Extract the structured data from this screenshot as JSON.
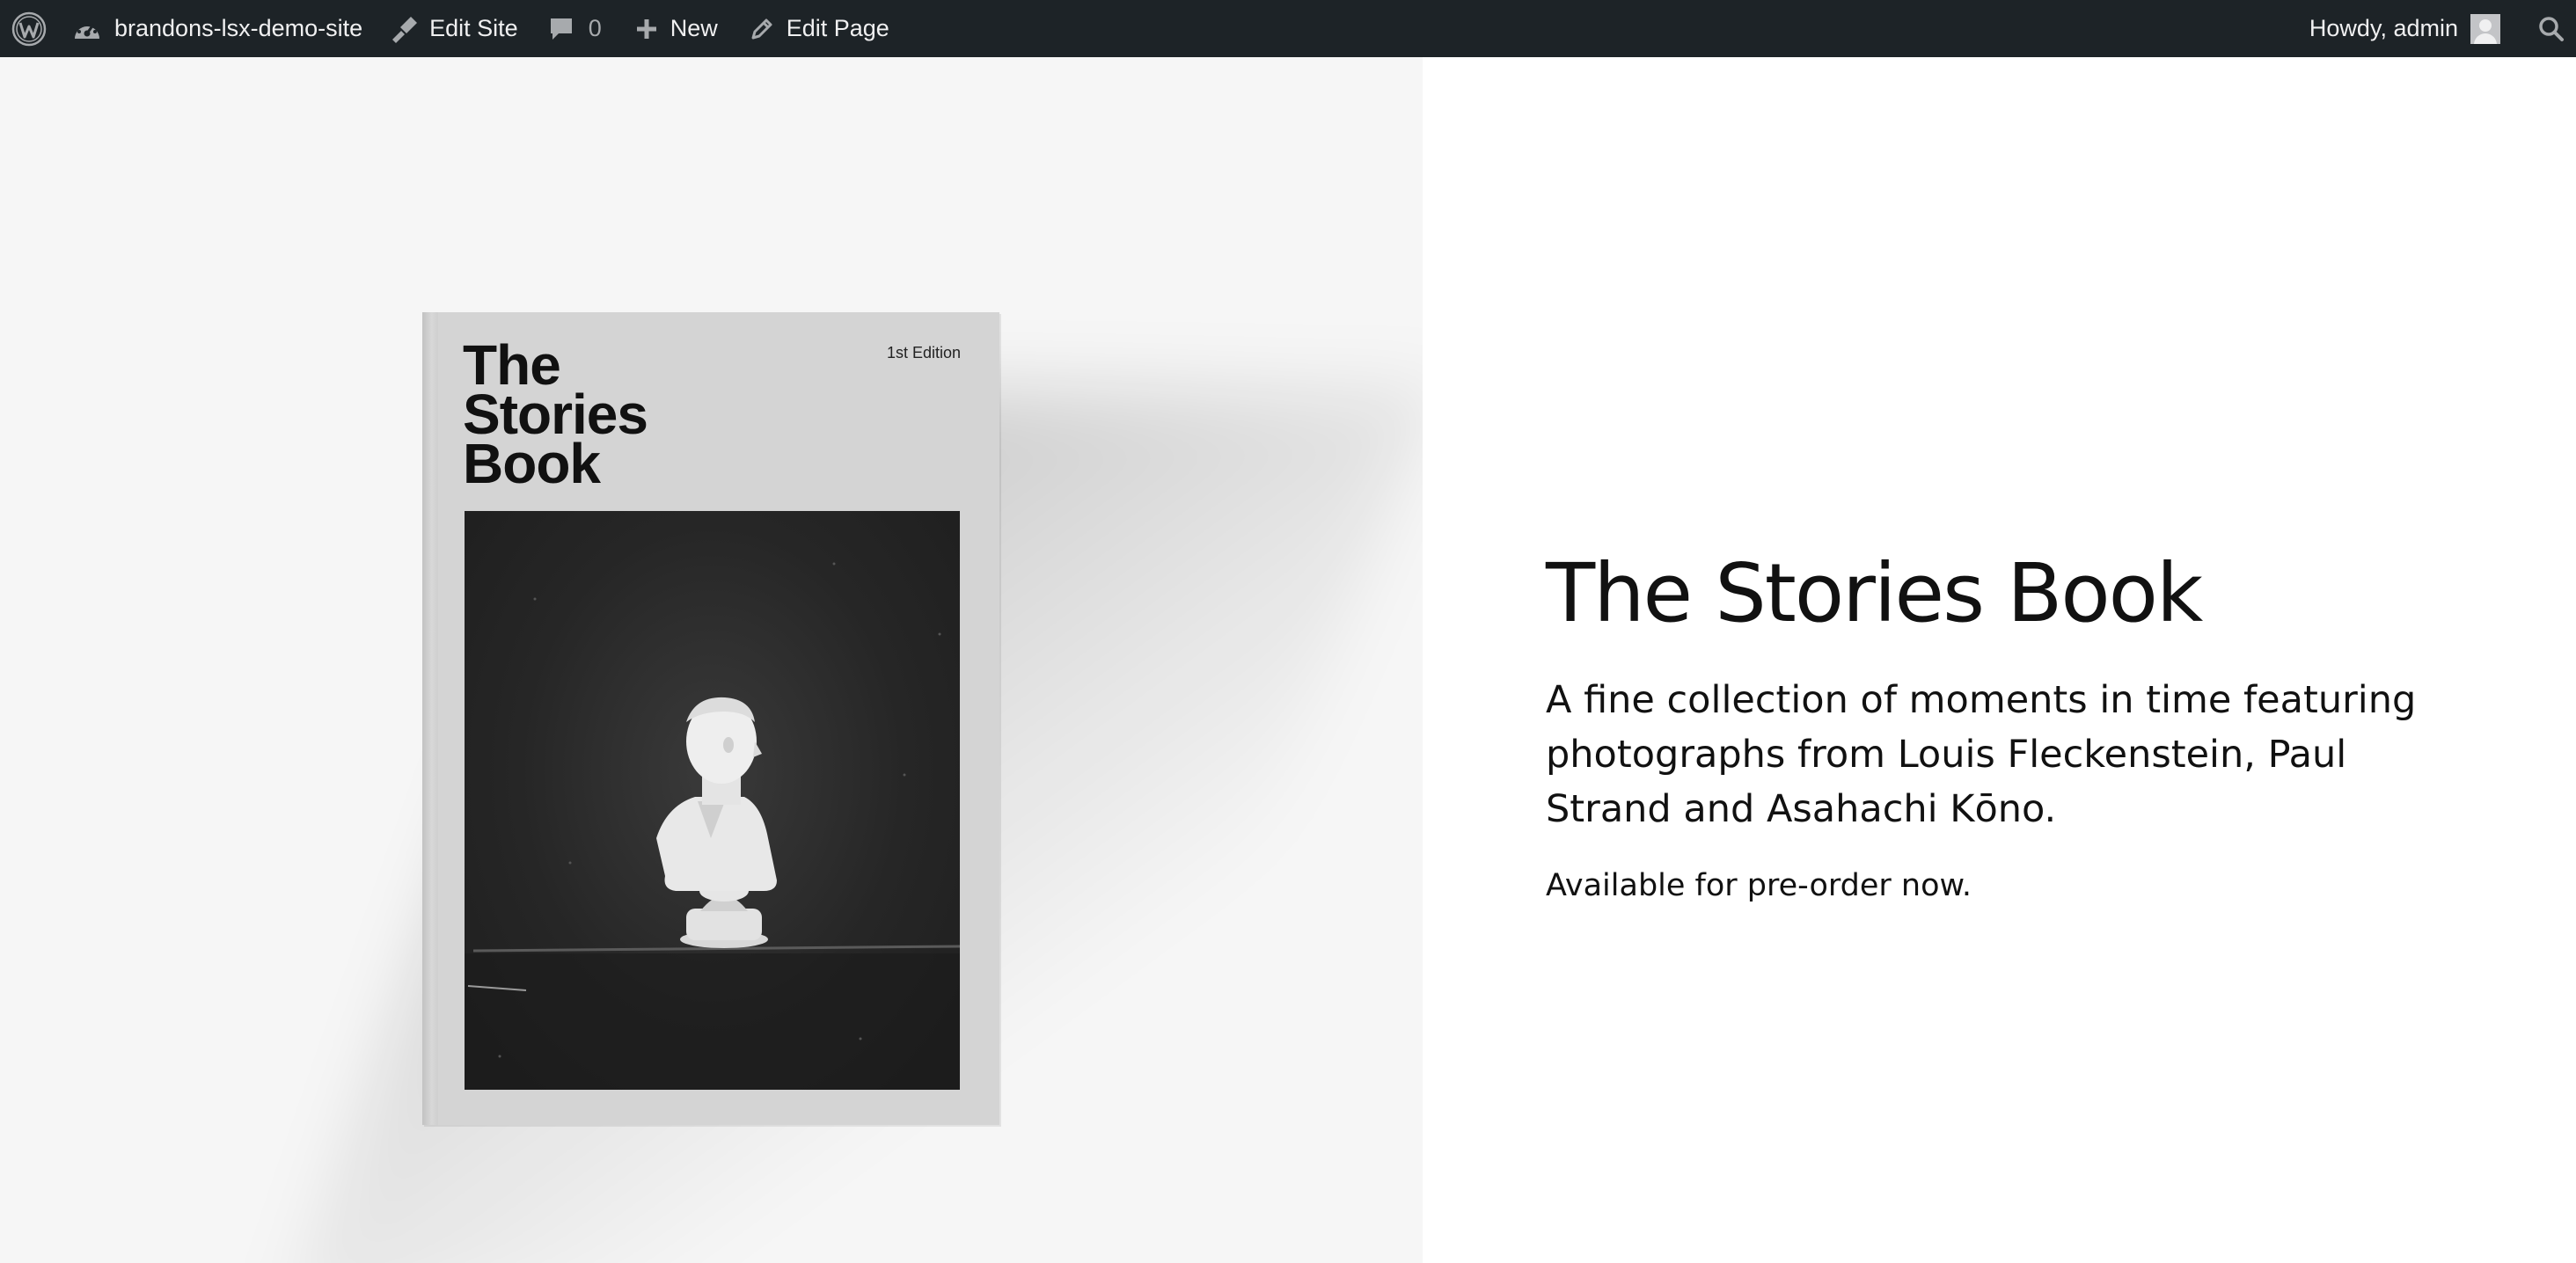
{
  "admin_bar": {
    "site_name": "brandons-lsx-demo-site",
    "edit_site_label": "Edit Site",
    "comments_count": "0",
    "new_label": "New",
    "edit_page_label": "Edit Page",
    "greeting": "Howdy, admin",
    "icons": {
      "logo": "wordpress-logo-icon",
      "site": "dashboard-gauge-icon",
      "edit_site": "brush-icon",
      "comments": "comment-bubble-icon",
      "new": "plus-icon",
      "edit_page": "pencil-icon",
      "search": "search-icon"
    },
    "colors": {
      "background": "#1d2327",
      "text": "#f0f0f1"
    }
  },
  "book_cover": {
    "title_lines": [
      "The",
      "Stories",
      "Book"
    ],
    "edition": "1st Edition",
    "image_subject": "marble bust photograph"
  },
  "hero": {
    "title": "The Stories Book",
    "description": "A fine collection of moments in time featuring photographs from Louis Fleckenstein, Paul Strand and Asahachi Kōno.",
    "cta_text": "Available for pre-order now."
  }
}
